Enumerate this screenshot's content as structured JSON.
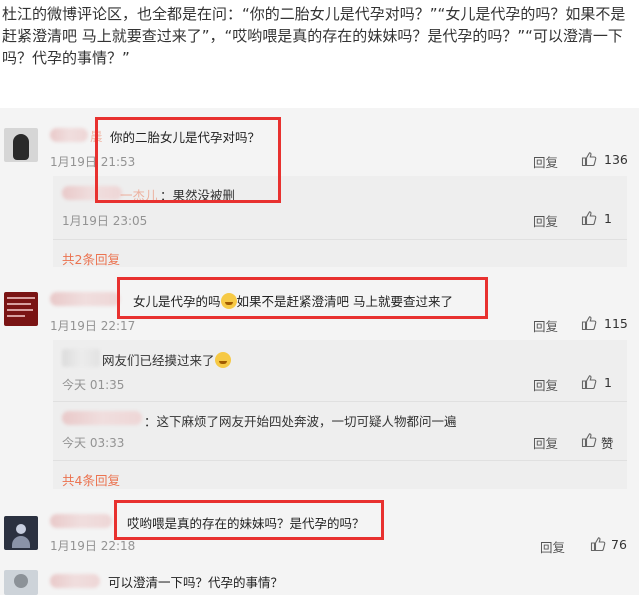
{
  "intro": "杜江的微博评论区，也全都是在问：“你的二胎女儿是代孕对吗？”“女儿是代孕的吗？如果不是赶紧澄清吧 马上就要查过来了”，“哎哟喂是真的存在的妹妹吗？是代孕的吗？”“可以澄清一下吗？代孕的事情？”",
  "labels": {
    "reply": "回复"
  },
  "comments": [
    {
      "name": "晨",
      "text": "你的二胎女儿是代孕对吗？",
      "time": "1月19日 21:53",
      "likes": "136",
      "replies": [
        {
          "name": "一杰儿",
          "text": "：果然没被删",
          "time": "1月19日 23:05",
          "likes": "1"
        }
      ],
      "more": "共2条回复"
    },
    {
      "text_before": "女儿是代孕的吗",
      "text_after": "如果不是赶紧澄清吧 马上就要查过来了",
      "emoji": "laugh-cry",
      "time": "1月19日 22:17",
      "likes": "115",
      "replies": [
        {
          "text": "网友们已经摸过来了",
          "emoji": "laugh-cry",
          "time": "今天 01:35",
          "likes": "1"
        },
        {
          "text": "：这下麻烦了网友开始四处奔波，一切可疑人物都问一遍",
          "time": "今天 03:33",
          "likes": "赞"
        }
      ],
      "more": "共4条回复"
    },
    {
      "text": "哎哟喂是真的存在的妹妹吗？是代孕的吗？",
      "time": "1月19日 22:18",
      "likes": "76"
    },
    {
      "text": "可以澄清一下吗？代孕的事情？"
    }
  ],
  "colors": {
    "highlight": "#e8312f",
    "link": "#eb7350",
    "panel": "#f4f4f4"
  }
}
